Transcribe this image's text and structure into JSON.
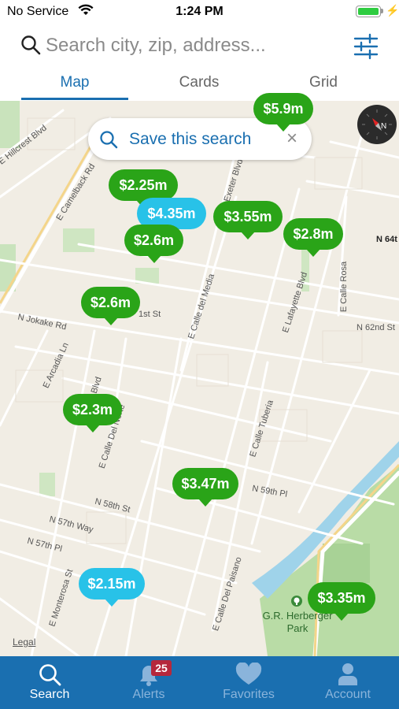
{
  "status_bar": {
    "carrier": "No Service",
    "time": "1:24 PM"
  },
  "search": {
    "placeholder": "Search city, zip, address..."
  },
  "tabs": [
    {
      "label": "Map",
      "active": true
    },
    {
      "label": "Cards",
      "active": false
    },
    {
      "label": "Grid",
      "active": false
    }
  ],
  "save_search": {
    "label": "Save this search",
    "close": "×"
  },
  "streets": [
    "E Hillcrest Blvd",
    "E Camelback Rd",
    "E Exeter Blvd",
    "N 64t",
    "E Calle Rosa",
    "N Jokake Rd",
    "1st St",
    "E Calle del Media",
    "E Lafayette Blvd",
    "N 62nd St",
    "E Arcadia Ln",
    "Blvd",
    "E Calle Del Norte",
    "E Calle Tuberia",
    "N 59th Pl",
    "N 58th St",
    "N 57th Way",
    "N 57th Pl",
    "E Monterosa St",
    "E Calle Del Paisano"
  ],
  "park": {
    "name": "G.R. Herberger\nPark"
  },
  "legal": "Legal",
  "listings": [
    {
      "price": "$5.9m",
      "color": "green"
    },
    {
      "price": "$2.25m",
      "color": "green"
    },
    {
      "price": "$4.35m",
      "color": "blue"
    },
    {
      "price": "$3.55m",
      "color": "green"
    },
    {
      "price": "$2.8m",
      "color": "green"
    },
    {
      "price": "$2.6m",
      "color": "green"
    },
    {
      "price": "$2.6m",
      "color": "green"
    },
    {
      "price": "$2.3m",
      "color": "green"
    },
    {
      "price": "$3.47m",
      "color": "green"
    },
    {
      "price": "$2.15m",
      "color": "blue"
    },
    {
      "price": "$3.35m",
      "color": "green"
    }
  ],
  "bottom_nav": [
    {
      "label": "Search",
      "icon": "search-icon",
      "active": true
    },
    {
      "label": "Alerts",
      "icon": "bell-icon",
      "active": false,
      "badge": "25"
    },
    {
      "label": "Favorites",
      "icon": "heart-icon",
      "active": false
    },
    {
      "label": "Account",
      "icon": "person-icon",
      "active": false
    }
  ],
  "colors": {
    "brand": "#1a6fb0",
    "pin_green": "#2aa418",
    "pin_blue": "#28c2e8",
    "badge": "#b5283c"
  }
}
